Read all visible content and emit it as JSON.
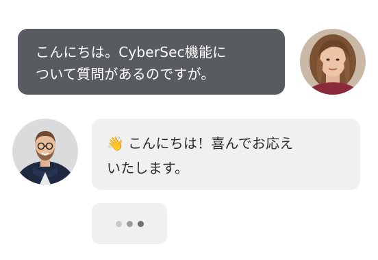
{
  "chat": {
    "messages": [
      {
        "sender": "user",
        "text": "こんにちは。CyberSec機能に\nついて質問があるのですが。"
      },
      {
        "sender": "agent",
        "icon": "waving-hand-icon",
        "emoji": "👋",
        "line1": "こんにちは！喜んでお応え",
        "line2": "いたします。"
      }
    ],
    "typing_indicator": {
      "dots": 3
    }
  },
  "colors": {
    "user_bubble": "#585b60",
    "agent_bubble": "#f0f0f0",
    "user_text": "#ffffff",
    "agent_text": "#2b2b2b"
  }
}
